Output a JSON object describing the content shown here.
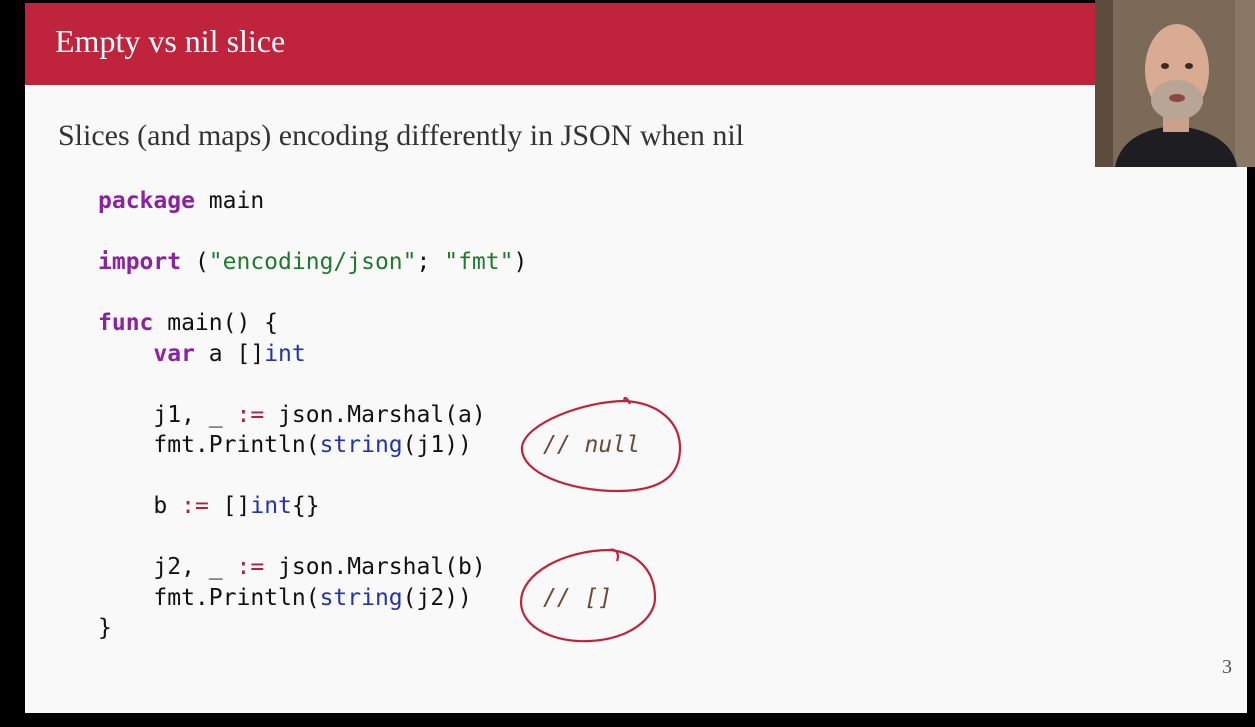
{
  "slide": {
    "title": "Empty vs nil slice",
    "subtitle": "Slices (and maps) encoding differently in JSON when nil",
    "page_number": "3"
  },
  "code": {
    "l1_kw": "package",
    "l1_rest": " main",
    "l2_kw": "import",
    "l2_a": " (",
    "l2_s1": "\"encoding/json\"",
    "l2_b": "; ",
    "l2_s2": "\"fmt\"",
    "l2_c": ")",
    "l3_kw": "func",
    "l3_rest": " main() {",
    "l4_pre": "    ",
    "l4_kw": "var",
    "l4_a": " a []",
    "l4_ty": "int",
    "l5_a": "    j1, _ ",
    "l5_op": ":=",
    "l5_b": " json.Marshal(a)",
    "l6_a": "    fmt.Println(",
    "l6_ty": "string",
    "l6_b": "(j1))",
    "l7_a": "    b ",
    "l7_op": ":=",
    "l7_b": " []",
    "l7_ty": "int",
    "l7_c": "{}",
    "l8_a": "    j2, _ ",
    "l8_op": ":=",
    "l8_b": " json.Marshal(b)",
    "l9_a": "    fmt.Println(",
    "l9_ty": "string",
    "l9_b": "(j2))",
    "l10": "}"
  },
  "comments": {
    "first": "// null",
    "second": "// []"
  },
  "colors": {
    "title_bar": "#c0233c",
    "keyword": "#8b22a0",
    "type": "#2233b0",
    "string": "#1e7a2e",
    "operator": "#b0203a",
    "annotation": "#c0233c"
  }
}
